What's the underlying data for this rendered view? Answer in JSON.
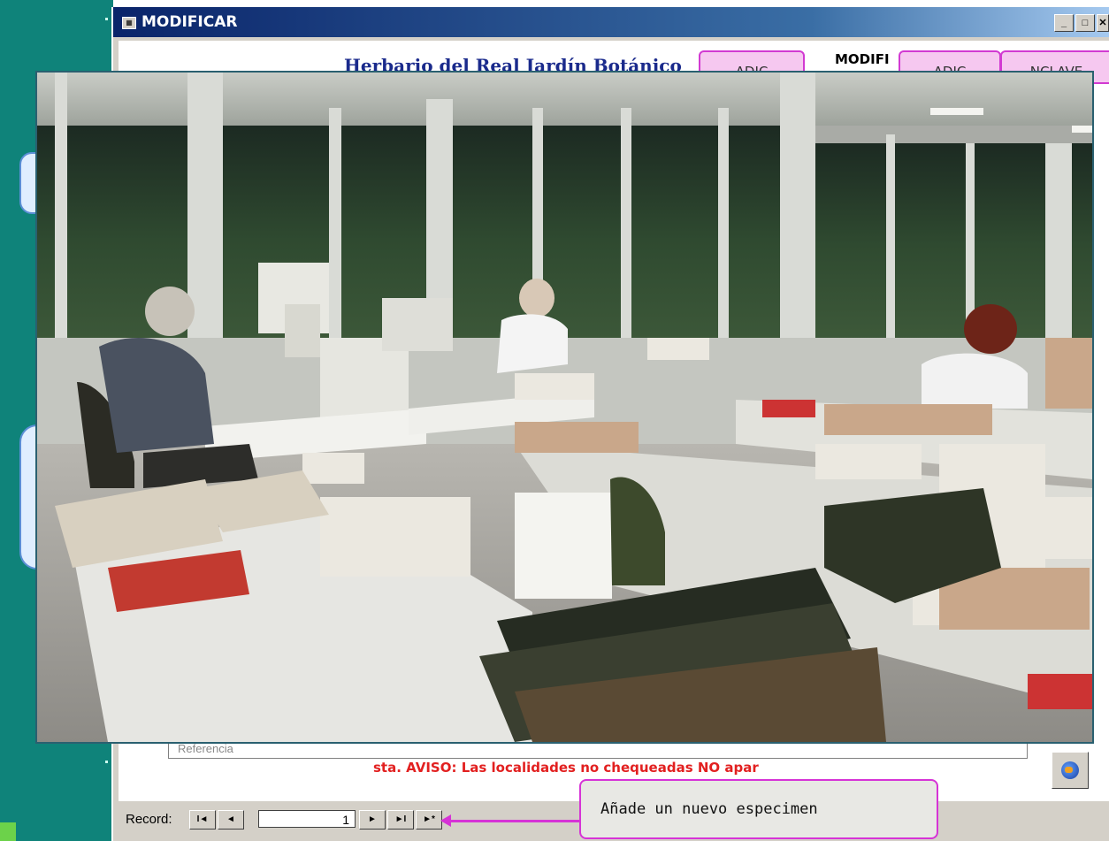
{
  "window": {
    "title": "MODIFICAR",
    "controls": [
      "_",
      "□",
      "✕"
    ]
  },
  "form": {
    "heading": "Herbario del Real Jardín Botánico",
    "mode_label": "MODIFI",
    "buttons": [
      {
        "label": "ADIC"
      },
      {
        "label": "ADIC"
      },
      {
        "label": "NCLAVE"
      }
    ],
    "bottom_field_value": "Referencia",
    "warning": "sta. AVISO: Las localidades no chequeadas NO apar"
  },
  "navigation": {
    "label": "Record:",
    "first": "I◄",
    "prev": "◄",
    "current": "1",
    "next": "►",
    "last": "►I",
    "new": "►*"
  },
  "callout": {
    "text": "Añade un nuevo especimen"
  },
  "photo": {
    "subject": "herbarium-workroom-photo"
  },
  "colors": {
    "teal": "#0f837a",
    "callout_border": "#d633d6",
    "warning": "#e22020",
    "heading": "#1a2a8c"
  }
}
